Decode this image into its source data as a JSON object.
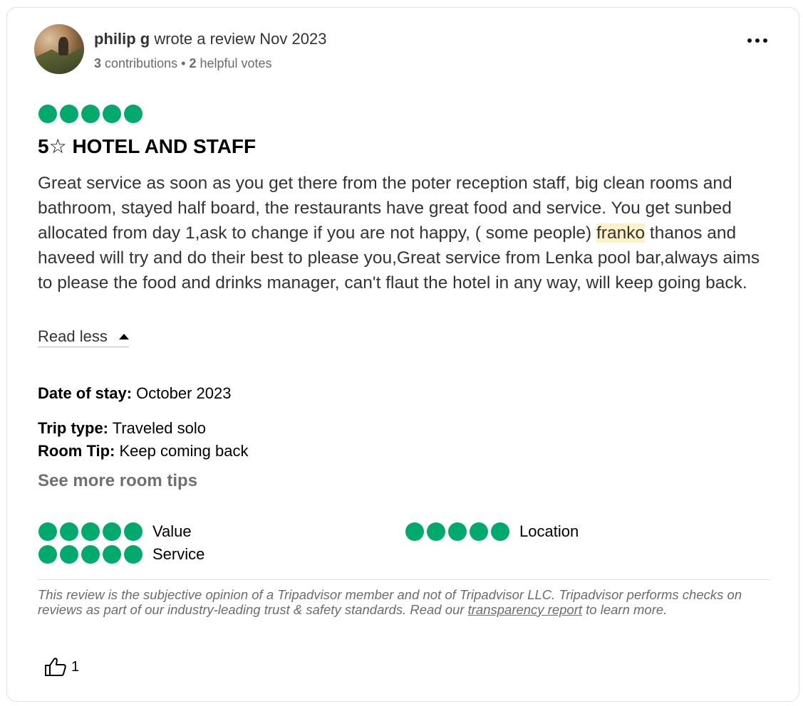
{
  "reviewer": {
    "name": "philip g",
    "action": "wrote a review Nov 2023",
    "contributions_count": "3",
    "contributions_label": "contributions",
    "separator": "•",
    "helpful_votes_count": "2",
    "helpful_votes_label": "helpful votes"
  },
  "review": {
    "rating": 5,
    "rating_max": 5,
    "title": "5☆ HOTEL AND STAFF",
    "body_before_highlight": "Great service as soon as you get there from the poter reception staff, big clean rooms and bathroom, stayed half board, the restaurants have great food and service. You get sunbed allocated from day 1,ask to change if you are not happy, ( some people) ",
    "highlight": "franko",
    "body_after_highlight": " thanos and haveed will try and do their best to please you,Great service from Lenka pool bar,always aims to please the food and drinks manager, can't flaut the hotel in any way, will keep going back.",
    "read_less_label": "Read less"
  },
  "details": {
    "date_of_stay_label": "Date of stay:",
    "date_of_stay_value": "October 2023",
    "trip_type_label": "Trip type:",
    "trip_type_value": "Traveled solo",
    "room_tip_label": "Room Tip:",
    "room_tip_value": "Keep coming back",
    "see_more_label": "See more room tips"
  },
  "sub_ratings": [
    {
      "label": "Value",
      "rating": 5
    },
    {
      "label": "Location",
      "rating": 5
    },
    {
      "label": "Service",
      "rating": 5
    }
  ],
  "disclaimer": {
    "text_before_link": "This review is the subjective opinion of a Tripadvisor member and not of Tripadvisor LLC. Tripadvisor performs checks on reviews as part of our industry-leading trust & safety standards. Read our ",
    "link_text": "transparency report",
    "text_after_link": " to learn more."
  },
  "helpful": {
    "count": "1",
    "icon": "thumbs-up-icon"
  },
  "colors": {
    "bubble": "#00aa6c",
    "highlight": "#fdf1c7",
    "muted_text": "#6b6b6b"
  }
}
